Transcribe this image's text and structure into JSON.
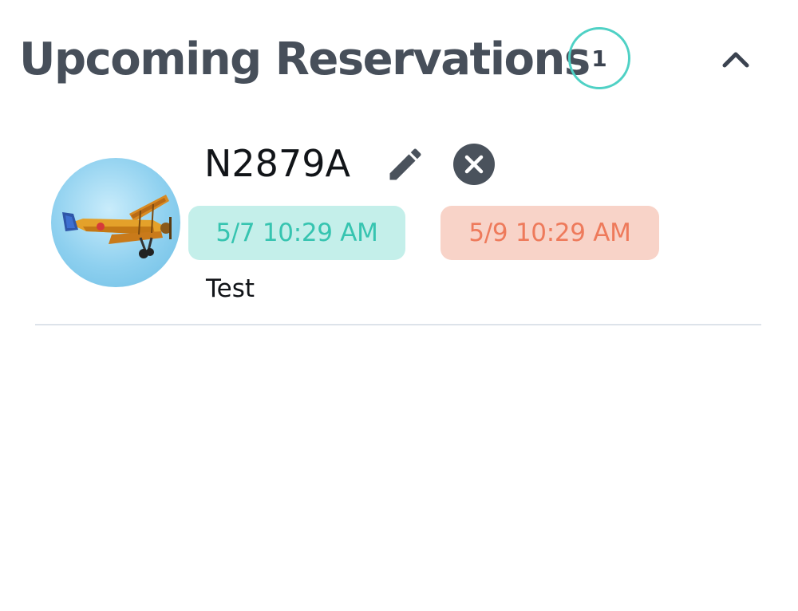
{
  "section": {
    "title": "Upcoming Reservations",
    "count": "1",
    "collapse_icon": "chevron-up-icon"
  },
  "reservations": [
    {
      "aircraft_image": "biplane-photo",
      "tail_number": "N2879A",
      "edit_icon": "pencil-icon",
      "cancel_icon": "close-circle-icon",
      "start_time": "5/7 10:29 AM",
      "end_time": "5/9 10:29 AM",
      "note": "Test"
    }
  ],
  "colors": {
    "title": "#474f5a",
    "badge_border": "#4fd1c5",
    "start_chip_bg": "#c4efea",
    "start_chip_text": "#36c4b0",
    "end_chip_bg": "#f8d3c8",
    "end_chip_text": "#ee7a5b",
    "icon": "#4a525c",
    "divider": "#dde3ea"
  }
}
